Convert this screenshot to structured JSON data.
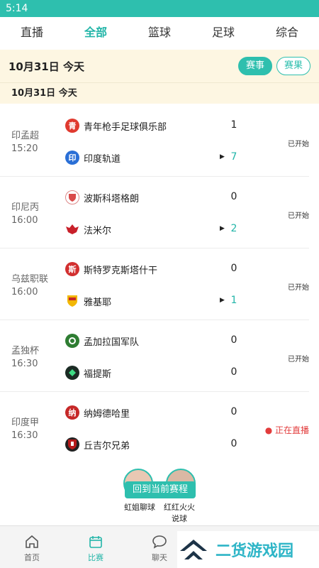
{
  "status_bar": {
    "time": "5:14"
  },
  "tabs": [
    {
      "label": "直播"
    },
    {
      "label": "全部"
    },
    {
      "label": "篮球"
    },
    {
      "label": "足球"
    },
    {
      "label": "综合"
    }
  ],
  "date_header": {
    "date": "10月31日  今天",
    "events_label": "赛事",
    "results_label": "赛果"
  },
  "sub_date": "10月31日  今天",
  "matches": [
    {
      "league": "印孟超",
      "time": "15:20",
      "home": "青年枪手足球俱乐部",
      "away": "印度轨道",
      "home_score": "1",
      "away_score": "7",
      "status": "已开始"
    },
    {
      "league": "印尼丙",
      "time": "16:00",
      "home": "波斯科塔格朗",
      "away": "法米尔",
      "home_score": "0",
      "away_score": "2",
      "status": "已开始"
    },
    {
      "league": "乌兹职联",
      "time": "16:00",
      "home": "斯特罗克斯塔什干",
      "away": "雅基耶",
      "home_score": "0",
      "away_score": "1",
      "status": "已开始"
    },
    {
      "league": "孟独杯",
      "time": "16:30",
      "home": "孟加拉国军队",
      "away": "福提斯",
      "home_score": "0",
      "away_score": "0",
      "status": "已开始"
    },
    {
      "league": "印度甲",
      "time": "16:30",
      "home": "纳姆德哈里",
      "away": "丘吉尔兄弟",
      "home_score": "0",
      "away_score": "0",
      "status": "● 正在直播"
    }
  ],
  "logos": {
    "m1_home": "青",
    "m1_away": "印",
    "m3_home": "斯",
    "m5_home": "纳"
  },
  "floating": {
    "return_label": "回到当前赛程",
    "streamer1": "虹姐聊球",
    "streamer2": "红红火火说球"
  },
  "nav": [
    {
      "label": "首页"
    },
    {
      "label": "比赛"
    },
    {
      "label": "聊天"
    }
  ],
  "watermark": "二货游戏园",
  "colors": {
    "accent": "#2ebfae",
    "live": "#e23c3c",
    "header_bg": "#fdf6e2"
  }
}
